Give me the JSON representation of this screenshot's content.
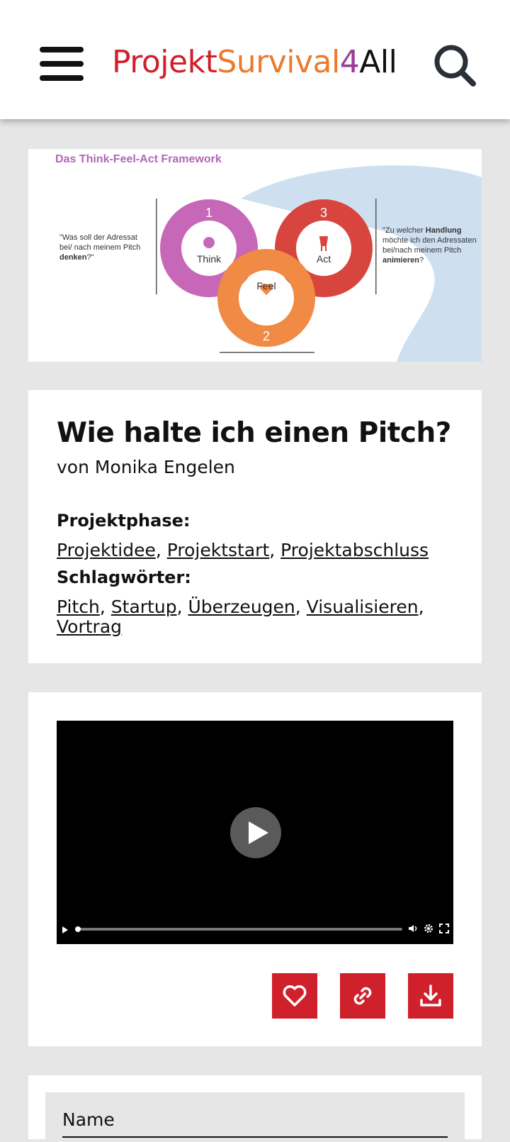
{
  "header": {
    "logo": {
      "part1": "Projekt",
      "part2": "Survival",
      "part3": "4",
      "part4": "All"
    },
    "menu_icon": "hamburger-menu-icon",
    "search_icon": "search-icon"
  },
  "figure": {
    "title": "Das Think-Feel-Act Framework",
    "left_text_1": "\"Was soll der Adressat",
    "left_text_2": "bei/ nach meinem Pitch",
    "left_text_3": "denken",
    "left_text_4": "?\"",
    "right_text_1": "\"Zu welcher ",
    "right_text_2": "Handlung",
    "right_text_3": "möchte ich den Adressaten",
    "right_text_4": "bei/nach meinem Pitch",
    "right_text_5": "animieren",
    "right_text_6": "?",
    "steps": [
      {
        "number": "1",
        "label": "Think"
      },
      {
        "number": "2",
        "label": "Feel"
      },
      {
        "number": "3",
        "label": "Act"
      }
    ]
  },
  "article": {
    "title": "Wie halte ich einen Pitch?",
    "author": "von Monika Engelen",
    "phase_label": "Projektphase:",
    "phases": [
      "Projektidee",
      "Projektstart",
      "Projektabschluss"
    ],
    "keywords_label": "Schlagwörter:",
    "keywords": [
      "Pitch",
      "Startup",
      "Überzeugen",
      "Visualisieren",
      "Vortrag"
    ]
  },
  "video": {
    "play_icon": "play-icon",
    "progress": 0.0
  },
  "actions": {
    "like_icon": "heart-icon",
    "link_icon": "link-icon",
    "download_icon": "download-icon"
  },
  "comment": {
    "name_label": "Name"
  },
  "colors": {
    "brand_red": "#d0202c",
    "brand_orange": "#ec7a2e",
    "brand_purple": "#9b3c96",
    "background": "#e6e6e6"
  }
}
